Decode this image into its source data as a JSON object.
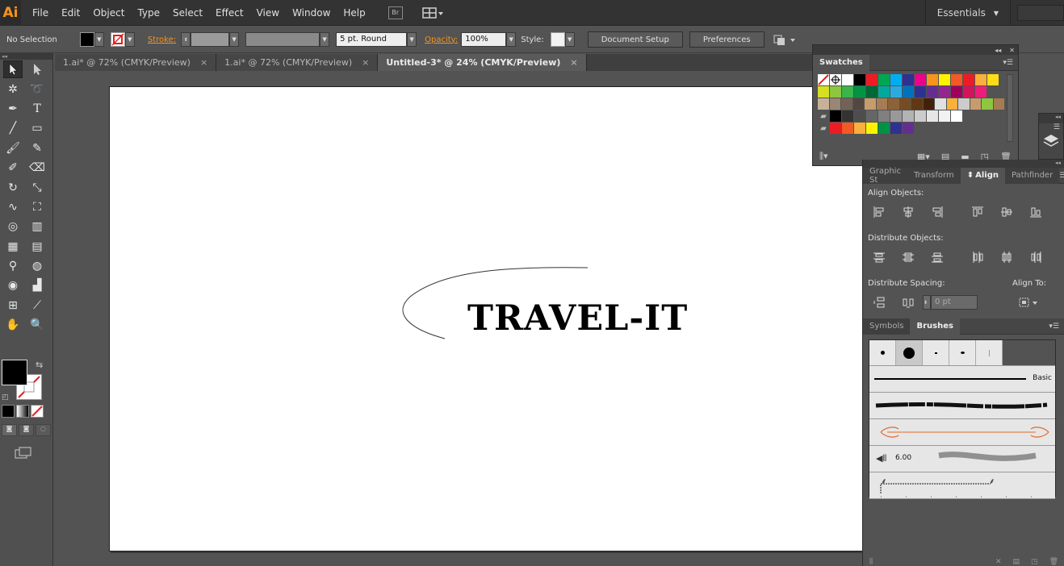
{
  "app": {
    "logo": "Ai",
    "bridge_label": "Br"
  },
  "menu": [
    "File",
    "Edit",
    "Object",
    "Type",
    "Select",
    "Effect",
    "View",
    "Window",
    "Help"
  ],
  "workspace": {
    "label": "Essentials"
  },
  "control": {
    "selection": "No Selection",
    "stroke_label": "Stroke:",
    "brush_value": "5 pt. Round",
    "opacity_label": "Opacity:",
    "opacity_value": "100%",
    "style_label": "Style:",
    "document_setup": "Document Setup",
    "preferences": "Preferences"
  },
  "tabs": [
    {
      "label": "1.ai* @ 72% (CMYK/Preview)",
      "close": "×"
    },
    {
      "label": "1.ai* @ 72% (CMYK/Preview)",
      "close": "×"
    },
    {
      "label": "Untitled-3* @ 24% (CMYK/Preview)",
      "close": "×",
      "active": true
    }
  ],
  "artboard": {
    "text": "TRAVEL-IT"
  },
  "swatches_panel": {
    "title": "Swatches",
    "rows": [
      [
        "none",
        "reg",
        "#ffffff",
        "#000000",
        "#ed1c24",
        "#00a651",
        "#00aeef",
        "#2e3192",
        "#ec008c",
        "#f7941d",
        "#fff200",
        "#f15a24",
        "#ed1c24",
        "#fbb03b",
        "#ffde17"
      ],
      [
        "#d7df23",
        "#8dc63f",
        "#39b54a",
        "#009444",
        "#006837",
        "#00a99d",
        "#29abe2",
        "#0071bc",
        "#2e3192",
        "#662d91",
        "#93278f",
        "#9e005d",
        "#d4145a",
        "#ed1e79"
      ],
      [
        "#c7b299",
        "#998675",
        "#736357",
        "#534741",
        "#c69c6d",
        "#a67c52",
        "#8c6239",
        "#754c24",
        "#603813",
        "#42210b",
        "#e0e0e0",
        "#fbb03b",
        "#cccccc",
        "#c69c6d",
        "#8dc63f",
        "#a67c52"
      ],
      [
        "folder",
        "#000000",
        "#333333",
        "#4d4d4d",
        "#666666",
        "#808080",
        "#999999",
        "#b3b3b3",
        "#cccccc",
        "#e6e6e6",
        "#f2f2f2",
        "#ffffff"
      ],
      [
        "folder",
        "#ed1c24",
        "#f15a24",
        "#fbb03b",
        "#fff200",
        "#009245",
        "#2e3192",
        "#662d91"
      ]
    ]
  },
  "align_panel": {
    "tabs": [
      "Graphic St",
      "Transform",
      "Align",
      "Pathfinder"
    ],
    "align_objects": "Align Objects:",
    "distribute_objects": "Distribute Objects:",
    "distribute_spacing": "Distribute Spacing:",
    "align_to": "Align To:",
    "spacing_value": "0 pt"
  },
  "brushes_panel": {
    "tabs": [
      "Symbols",
      "Brushes"
    ],
    "basic_label": "Basic",
    "bristle_value": "6.00"
  }
}
